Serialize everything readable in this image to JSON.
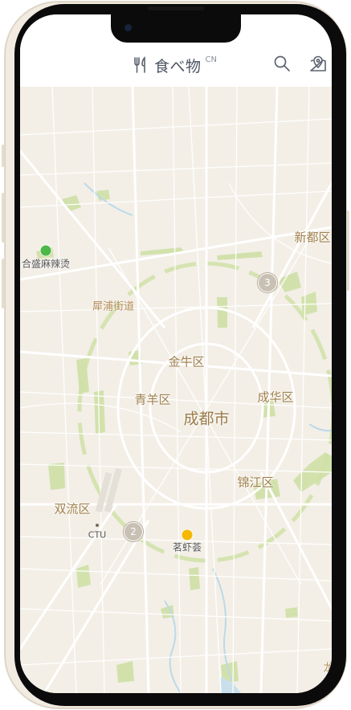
{
  "header": {
    "app_title": "食べ物",
    "region_code": "CN",
    "icons": {
      "brand": "fork-knife-icon",
      "search": "search-icon",
      "location": "map-pin-icon"
    }
  },
  "map": {
    "city_label": "成都市",
    "district_labels": {
      "jinniu": "金牛区",
      "qingyang": "青羊区",
      "chenghua": "成华区",
      "jinjiang": "锦江区",
      "shuangliu": "双流区",
      "xindu": "新都区",
      "xipu": "犀浦街道"
    },
    "edge_label": "龙",
    "airport_label": "CTU",
    "pois": [
      {
        "name": "合盛麻辣烫",
        "color": "#4cb848"
      },
      {
        "name": "茗虾荟",
        "color": "#f5b800"
      }
    ],
    "clusters": [
      {
        "count": "3"
      },
      {
        "count": "2"
      }
    ]
  }
}
